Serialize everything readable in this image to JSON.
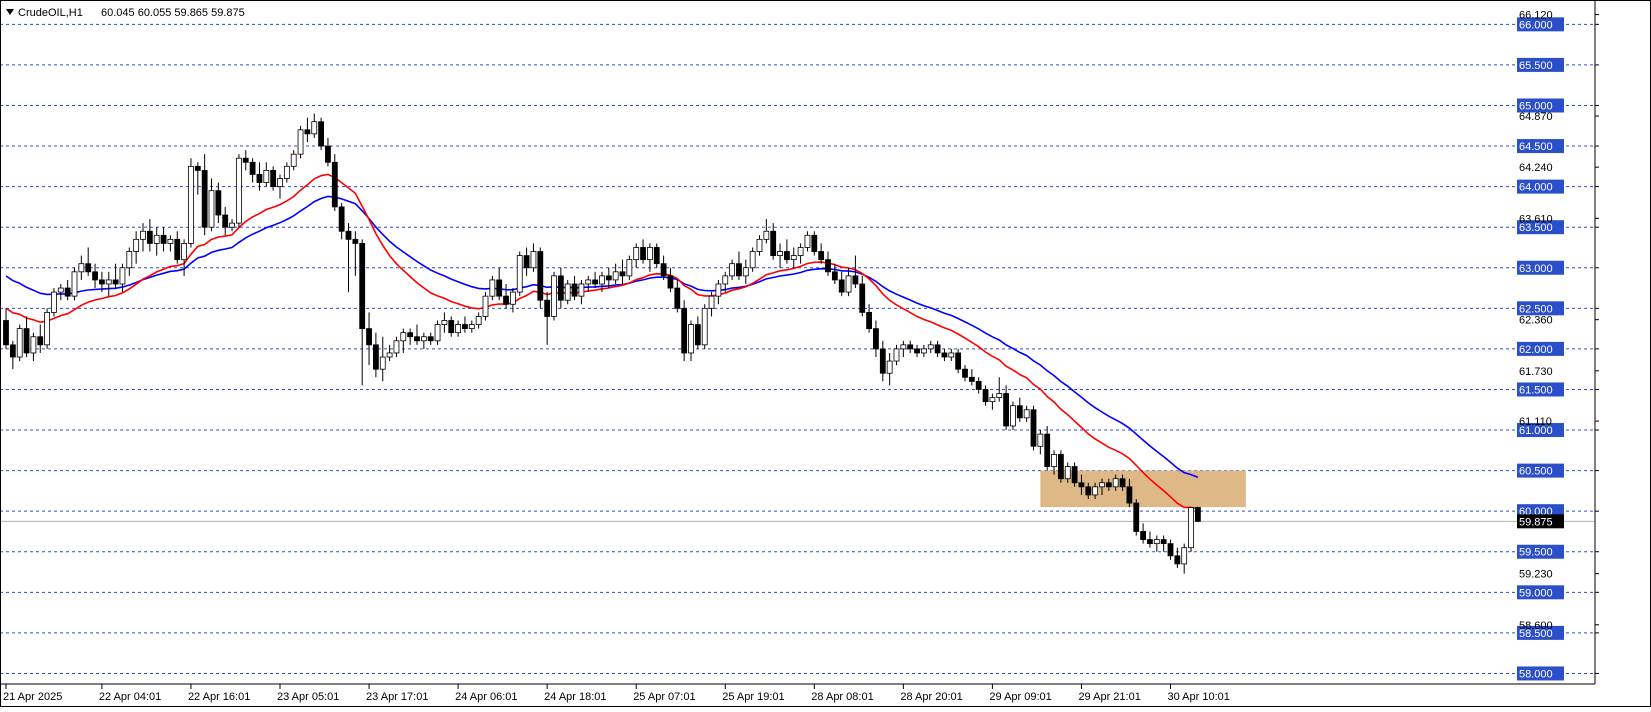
{
  "header": {
    "symbol": "CrudeOIL,H1",
    "ohlc": "60.045 60.055 59.865 59.875",
    "menu_icon": "triangle-down-icon"
  },
  "colors": {
    "background": "#ffffff",
    "grid": "#2b4fc9",
    "candle_up_fill": "#ffffff",
    "candle_down_fill": "#000000",
    "candle_outline": "#000000",
    "ema_fast": "#ff0000",
    "ema_slow": "#0000ff",
    "zone": "#deb887",
    "price_tag_bg": "#000000",
    "price_tag_text": "#ffffff",
    "bid_line": "#b0b0b0"
  },
  "chart_data": {
    "type": "candlestick",
    "title": "CrudeOIL,H1",
    "ylim": [
      57.87,
      66.3
    ],
    "current_price": 59.875,
    "current_price_label": "59.875",
    "grid": true,
    "grid_levels": [
      66.0,
      65.5,
      65.0,
      64.5,
      64.0,
      63.5,
      63.0,
      62.5,
      62.0,
      61.5,
      61.0,
      60.5,
      60.0,
      59.5,
      59.0,
      58.5,
      58.0
    ],
    "grid_level_labels": [
      "66.000",
      "65.500",
      "65.000",
      "64.500",
      "64.000",
      "63.500",
      "63.000",
      "62.500",
      "62.000",
      "61.500",
      "61.000",
      "60.500",
      "60.000",
      "59.500",
      "59.000",
      "58.500",
      "58.000"
    ],
    "plain_axis_ticks": [
      66.12,
      64.87,
      64.24,
      63.61,
      62.36,
      61.73,
      61.11,
      59.23,
      58.6
    ],
    "plain_axis_tick_labels": [
      "66.120",
      "64.870",
      "64.240",
      "63.610",
      "62.360",
      "61.730",
      "61.110",
      "59.230",
      "58.600"
    ],
    "x_tick_labels": [
      "21 Apr 2025",
      "22 Apr 04:01",
      "22 Apr 16:01",
      "23 Apr 05:01",
      "23 Apr 17:01",
      "24 Apr 06:01",
      "24 Apr 18:01",
      "25 Apr 07:01",
      "25 Apr 19:01",
      "28 Apr 08:01",
      "28 Apr 20:01",
      "29 Apr 09:01",
      "29 Apr 21:01",
      "30 Apr 10:01"
    ],
    "x_tick_bar_index": [
      0,
      14,
      27,
      40,
      53,
      66,
      79,
      92,
      105,
      118,
      131,
      144,
      157,
      170
    ],
    "zone": {
      "bar_from": 151,
      "bar_to": 181,
      "price_low": 60.05,
      "price_high": 60.5
    },
    "ohlc": [
      [
        62.35,
        62.5,
        62.0,
        62.05
      ],
      [
        62.05,
        62.1,
        61.75,
        61.9
      ],
      [
        61.9,
        62.3,
        61.85,
        62.25
      ],
      [
        62.25,
        62.4,
        61.9,
        61.95
      ],
      [
        61.95,
        62.2,
        61.85,
        62.15
      ],
      [
        62.15,
        62.3,
        61.95,
        62.05
      ],
      [
        62.05,
        62.5,
        62.0,
        62.45
      ],
      [
        62.45,
        62.75,
        62.4,
        62.7
      ],
      [
        62.7,
        62.8,
        62.6,
        62.75
      ],
      [
        62.75,
        62.85,
        62.6,
        62.65
      ],
      [
        62.65,
        63.0,
        62.6,
        62.95
      ],
      [
        62.95,
        63.15,
        62.85,
        63.05
      ],
      [
        63.05,
        63.25,
        62.9,
        62.95
      ],
      [
        62.95,
        63.05,
        62.75,
        62.85
      ],
      [
        62.85,
        62.95,
        62.7,
        62.8
      ],
      [
        62.8,
        62.95,
        62.65,
        62.85
      ],
      [
        62.85,
        63.05,
        62.75,
        62.8
      ],
      [
        62.8,
        63.05,
        62.7,
        63.0
      ],
      [
        63.0,
        63.25,
        62.9,
        63.2
      ],
      [
        63.2,
        63.45,
        63.05,
        63.35
      ],
      [
        63.35,
        63.55,
        63.2,
        63.45
      ],
      [
        63.45,
        63.6,
        63.2,
        63.3
      ],
      [
        63.3,
        63.5,
        63.15,
        63.4
      ],
      [
        63.4,
        63.5,
        63.2,
        63.3
      ],
      [
        63.3,
        63.4,
        63.2,
        63.35
      ],
      [
        63.35,
        63.45,
        63.05,
        63.1
      ],
      [
        63.1,
        63.35,
        62.9,
        63.3
      ],
      [
        63.3,
        64.35,
        63.25,
        64.25
      ],
      [
        64.25,
        64.3,
        63.9,
        64.2
      ],
      [
        64.2,
        64.4,
        63.4,
        63.5
      ],
      [
        63.5,
        64.1,
        63.45,
        63.95
      ],
      [
        63.95,
        64.05,
        63.55,
        63.65
      ],
      [
        63.65,
        63.75,
        63.4,
        63.5
      ],
      [
        63.5,
        63.6,
        63.45,
        63.55
      ],
      [
        63.55,
        64.4,
        63.5,
        64.35
      ],
      [
        64.35,
        64.45,
        64.2,
        64.3
      ],
      [
        64.3,
        64.35,
        64.05,
        64.15
      ],
      [
        64.15,
        64.3,
        63.95,
        64.05
      ],
      [
        64.05,
        64.3,
        64.0,
        64.2
      ],
      [
        64.2,
        64.25,
        63.95,
        64.0
      ],
      [
        64.0,
        64.15,
        63.85,
        64.1
      ],
      [
        64.1,
        64.3,
        64.05,
        64.25
      ],
      [
        64.25,
        64.45,
        64.2,
        64.4
      ],
      [
        64.4,
        64.75,
        64.35,
        64.7
      ],
      [
        64.7,
        64.85,
        64.55,
        64.65
      ],
      [
        64.65,
        64.9,
        64.6,
        64.8
      ],
      [
        64.8,
        64.85,
        64.45,
        64.5
      ],
      [
        64.5,
        64.6,
        64.25,
        64.3
      ],
      [
        64.3,
        64.4,
        63.7,
        63.75
      ],
      [
        63.75,
        63.8,
        63.35,
        63.45
      ],
      [
        63.45,
        63.55,
        62.7,
        63.35
      ],
      [
        63.35,
        63.45,
        62.9,
        63.3
      ],
      [
        63.3,
        63.35,
        61.55,
        62.25
      ],
      [
        62.25,
        62.45,
        61.8,
        62.05
      ],
      [
        62.05,
        62.2,
        61.65,
        61.75
      ],
      [
        61.75,
        62.15,
        61.6,
        61.9
      ],
      [
        61.9,
        62.05,
        61.85,
        61.95
      ],
      [
        61.95,
        62.15,
        61.9,
        62.1
      ],
      [
        62.1,
        62.25,
        61.95,
        62.2
      ],
      [
        62.2,
        62.25,
        62.05,
        62.15
      ],
      [
        62.15,
        62.3,
        62.05,
        62.1
      ],
      [
        62.1,
        62.2,
        62.0,
        62.15
      ],
      [
        62.15,
        62.2,
        62.05,
        62.1
      ],
      [
        62.1,
        62.35,
        62.05,
        62.3
      ],
      [
        62.3,
        62.45,
        62.2,
        62.35
      ],
      [
        62.35,
        62.4,
        62.15,
        62.2
      ],
      [
        62.2,
        62.35,
        62.15,
        62.3
      ],
      [
        62.3,
        62.4,
        62.2,
        62.25
      ],
      [
        62.25,
        62.35,
        62.2,
        62.3
      ],
      [
        62.3,
        62.45,
        62.25,
        62.4
      ],
      [
        62.4,
        62.7,
        62.35,
        62.65
      ],
      [
        62.65,
        62.9,
        62.6,
        62.85
      ],
      [
        62.85,
        63.0,
        62.6,
        62.65
      ],
      [
        62.65,
        62.8,
        62.5,
        62.55
      ],
      [
        62.55,
        62.75,
        62.45,
        62.7
      ],
      [
        62.7,
        63.2,
        62.65,
        63.15
      ],
      [
        63.15,
        63.25,
        62.9,
        63.0
      ],
      [
        63.0,
        63.3,
        62.95,
        63.2
      ],
      [
        63.2,
        63.25,
        62.5,
        62.6
      ],
      [
        62.6,
        62.7,
        62.05,
        62.4
      ],
      [
        62.4,
        62.95,
        62.35,
        62.9
      ],
      [
        62.9,
        63.0,
        62.5,
        62.6
      ],
      [
        62.6,
        62.85,
        62.55,
        62.8
      ],
      [
        62.8,
        62.9,
        62.6,
        62.65
      ],
      [
        62.65,
        62.85,
        62.55,
        62.8
      ],
      [
        62.8,
        62.9,
        62.7,
        62.85
      ],
      [
        62.85,
        62.95,
        62.75,
        62.8
      ],
      [
        62.8,
        62.95,
        62.7,
        62.9
      ],
      [
        62.9,
        63.0,
        62.75,
        62.85
      ],
      [
        62.85,
        63.05,
        62.8,
        62.95
      ],
      [
        62.95,
        63.1,
        62.8,
        62.9
      ],
      [
        62.9,
        63.15,
        62.85,
        63.1
      ],
      [
        63.1,
        63.3,
        63.0,
        63.25
      ],
      [
        63.25,
        63.35,
        63.05,
        63.1
      ],
      [
        63.1,
        63.3,
        62.95,
        63.25
      ],
      [
        63.25,
        63.3,
        63.0,
        63.05
      ],
      [
        63.05,
        63.15,
        62.85,
        62.9
      ],
      [
        62.9,
        63.0,
        62.7,
        62.75
      ],
      [
        62.75,
        62.85,
        62.45,
        62.5
      ],
      [
        62.5,
        62.6,
        61.85,
        61.95
      ],
      [
        61.95,
        62.35,
        61.85,
        62.3
      ],
      [
        62.3,
        62.4,
        62.0,
        62.05
      ],
      [
        62.05,
        62.55,
        62.0,
        62.5
      ],
      [
        62.5,
        62.7,
        62.4,
        62.65
      ],
      [
        62.65,
        62.85,
        62.55,
        62.8
      ],
      [
        62.8,
        62.95,
        62.7,
        62.9
      ],
      [
        62.9,
        63.1,
        62.85,
        63.05
      ],
      [
        63.05,
        63.2,
        62.85,
        62.9
      ],
      [
        62.9,
        63.1,
        62.8,
        63.0
      ],
      [
        63.0,
        63.25,
        62.95,
        63.2
      ],
      [
        63.2,
        63.4,
        63.15,
        63.35
      ],
      [
        63.35,
        63.6,
        63.3,
        63.45
      ],
      [
        63.45,
        63.55,
        63.1,
        63.15
      ],
      [
        63.15,
        63.3,
        63.0,
        63.2
      ],
      [
        63.2,
        63.35,
        63.05,
        63.1
      ],
      [
        63.1,
        63.25,
        63.0,
        63.15
      ],
      [
        63.15,
        63.3,
        63.05,
        63.25
      ],
      [
        63.25,
        63.45,
        63.2,
        63.4
      ],
      [
        63.4,
        63.45,
        63.15,
        63.2
      ],
      [
        63.2,
        63.3,
        63.05,
        63.1
      ],
      [
        63.1,
        63.2,
        62.9,
        62.95
      ],
      [
        62.95,
        63.05,
        62.8,
        62.85
      ],
      [
        62.85,
        62.95,
        62.65,
        62.7
      ],
      [
        62.7,
        63.0,
        62.65,
        62.9
      ],
      [
        62.9,
        63.15,
        62.75,
        62.8
      ],
      [
        62.8,
        62.9,
        62.4,
        62.45
      ],
      [
        62.45,
        62.55,
        62.2,
        62.25
      ],
      [
        62.25,
        62.35,
        61.9,
        62.0
      ],
      [
        62.0,
        62.1,
        61.6,
        61.7
      ],
      [
        61.7,
        61.95,
        61.55,
        61.85
      ],
      [
        61.85,
        62.05,
        61.8,
        62.0
      ],
      [
        62.0,
        62.1,
        61.9,
        62.05
      ],
      [
        62.05,
        62.1,
        61.95,
        62.0
      ],
      [
        62.0,
        62.05,
        61.9,
        61.95
      ],
      [
        61.95,
        62.05,
        61.9,
        62.0
      ],
      [
        62.0,
        62.1,
        61.95,
        62.05
      ],
      [
        62.05,
        62.1,
        61.9,
        61.95
      ],
      [
        61.95,
        62.0,
        61.85,
        61.9
      ],
      [
        61.9,
        62.0,
        61.85,
        61.95
      ],
      [
        61.95,
        62.0,
        61.7,
        61.75
      ],
      [
        61.75,
        61.8,
        61.6,
        61.65
      ],
      [
        61.65,
        61.75,
        61.55,
        61.6
      ],
      [
        61.6,
        61.65,
        61.45,
        61.5
      ],
      [
        61.5,
        61.55,
        61.3,
        61.35
      ],
      [
        61.35,
        61.45,
        61.25,
        61.4
      ],
      [
        61.4,
        61.65,
        61.35,
        61.45
      ],
      [
        61.45,
        61.55,
        61.0,
        61.05
      ],
      [
        61.05,
        61.35,
        61.0,
        61.3
      ],
      [
        61.3,
        61.4,
        61.1,
        61.15
      ],
      [
        61.15,
        61.3,
        61.1,
        61.25
      ],
      [
        61.25,
        61.3,
        60.75,
        60.8
      ],
      [
        60.8,
        61.0,
        60.7,
        60.95
      ],
      [
        60.95,
        61.05,
        60.5,
        60.55
      ],
      [
        60.55,
        60.75,
        60.45,
        60.7
      ],
      [
        60.7,
        60.75,
        60.35,
        60.4
      ],
      [
        60.4,
        60.6,
        60.35,
        60.55
      ],
      [
        60.55,
        60.6,
        60.3,
        60.35
      ],
      [
        60.35,
        60.45,
        60.2,
        60.3
      ],
      [
        60.3,
        60.35,
        60.15,
        60.2
      ],
      [
        60.2,
        60.35,
        60.15,
        60.3
      ],
      [
        60.3,
        60.4,
        60.2,
        60.35
      ],
      [
        60.35,
        60.4,
        60.25,
        60.3
      ],
      [
        60.3,
        60.45,
        60.25,
        60.4
      ],
      [
        60.4,
        60.45,
        60.25,
        60.3
      ],
      [
        60.3,
        60.4,
        60.05,
        60.1
      ],
      [
        60.1,
        60.15,
        59.7,
        59.75
      ],
      [
        59.75,
        59.85,
        59.6,
        59.65
      ],
      [
        59.65,
        59.75,
        59.55,
        59.6
      ],
      [
        59.6,
        59.7,
        59.5,
        59.65
      ],
      [
        59.65,
        59.7,
        59.5,
        59.6
      ],
      [
        59.6,
        59.65,
        59.4,
        59.45
      ],
      [
        59.45,
        59.55,
        59.3,
        59.35
      ],
      [
        59.35,
        59.6,
        59.23,
        59.55
      ],
      [
        59.55,
        60.05,
        59.5,
        60.045
      ],
      [
        60.045,
        60.055,
        59.865,
        59.875
      ]
    ]
  }
}
